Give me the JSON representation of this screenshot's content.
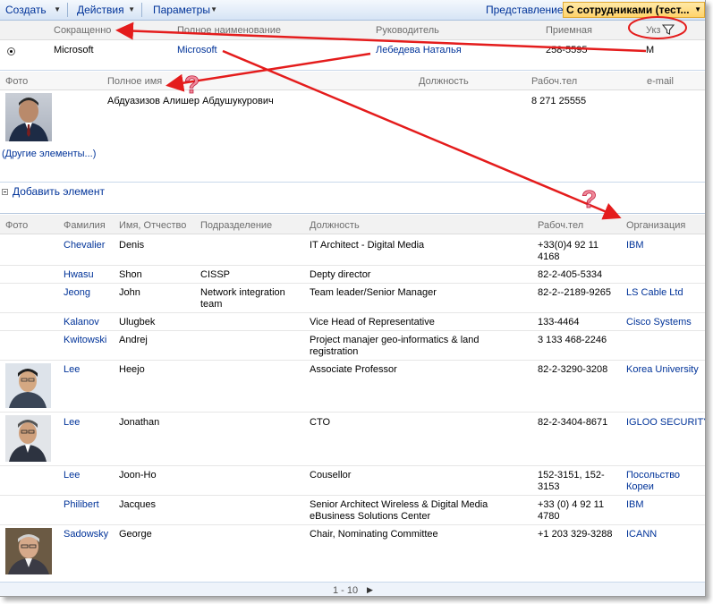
{
  "toolbar": {
    "new_label": "Создать",
    "actions_label": "Действия",
    "settings_label": "Параметры",
    "view_label": "Представление:",
    "view_value": "С сотрудниками (тест..."
  },
  "company_list": {
    "headers": {
      "short": "Сокращенно",
      "full": "Полное наименование",
      "head": "Руководитель",
      "reception": "Приемная",
      "ukz": "Укз"
    },
    "row": {
      "short": "Microsoft",
      "full": "Microsoft",
      "head": "Лебедева Наталья",
      "reception": "258-5595",
      "ukz": "М"
    }
  },
  "related_view": {
    "headers": {
      "photo": "Фото",
      "full_name": "Полное имя",
      "position": "Должность",
      "work_phone": "Рабоч.тел",
      "email": "e-mail"
    },
    "row": {
      "full_name": "Абдуазизов Алишер Абдушукурович",
      "work_phone": "8 271 25555"
    },
    "more_items": "(Другие элементы...)"
  },
  "add_item_label": "Добавить элемент",
  "contacts": {
    "headers": {
      "photo": "Фото",
      "last_name": "Фамилия",
      "first_name": "Имя, Отчество",
      "department": "Подразделение",
      "position": "Должность",
      "work_phone": "Рабоч.тел",
      "organization": "Организация"
    },
    "rows": [
      {
        "last_name": "Chevalier",
        "first_name": "Denis",
        "department": "",
        "position": "IT Architect - Digital Media",
        "work_phone": "+33(0)4 92 11 4168",
        "organization": "IBM"
      },
      {
        "last_name": "Hwasu",
        "first_name": "Shon",
        "department": "CISSP",
        "position": "Depty director",
        "work_phone": "82-2-405-5334",
        "organization": ""
      },
      {
        "last_name": "Jeong",
        "first_name": "John",
        "department": "Network integration team",
        "position": "Team leader/Senior Manager",
        "work_phone": "82-2--2189-9265",
        "organization": "LS Cable Ltd"
      },
      {
        "last_name": "Kalanov",
        "first_name": "Ulugbek",
        "department": "",
        "position": "Vice Head of Representative",
        "work_phone": "133-4464",
        "organization": "Cisco Systems"
      },
      {
        "last_name": "Kwitowski",
        "first_name": "Andrej",
        "department": "",
        "position": "Project manajer geo-informatics & land registration",
        "work_phone": "3 133 468-2246",
        "organization": ""
      },
      {
        "last_name": "Lee",
        "first_name": "Heejo",
        "department": "",
        "position": "Associate Professor",
        "work_phone": "82-2-3290-3208",
        "organization": "Korea University"
      },
      {
        "last_name": "Lee",
        "first_name": "Jonathan",
        "department": "",
        "position": "CTO",
        "work_phone": "82-2-3404-8671",
        "organization": "IGLOO SECURITY"
      },
      {
        "last_name": "Lee",
        "first_name": "Joon-Ho",
        "department": "",
        "position": "Cousellor",
        "work_phone": "152-3151, 152-3153",
        "organization": "Посольство Кореи"
      },
      {
        "last_name": "Philibert",
        "first_name": "Jacques",
        "department": "",
        "position": "Senior Architect Wireless & Digital Media eBusiness Solutions Center",
        "work_phone": "+33 (0) 4 92 11 4780",
        "organization": "IBM"
      },
      {
        "last_name": "Sadowsky",
        "first_name": "George",
        "department": "",
        "position": "Chair, Nominating Committee",
        "work_phone": "+1 203 329-3288",
        "organization": "ICANN"
      }
    ]
  },
  "pager": {
    "range": "1 - 10"
  },
  "annotations": {
    "question_mark": "?"
  }
}
